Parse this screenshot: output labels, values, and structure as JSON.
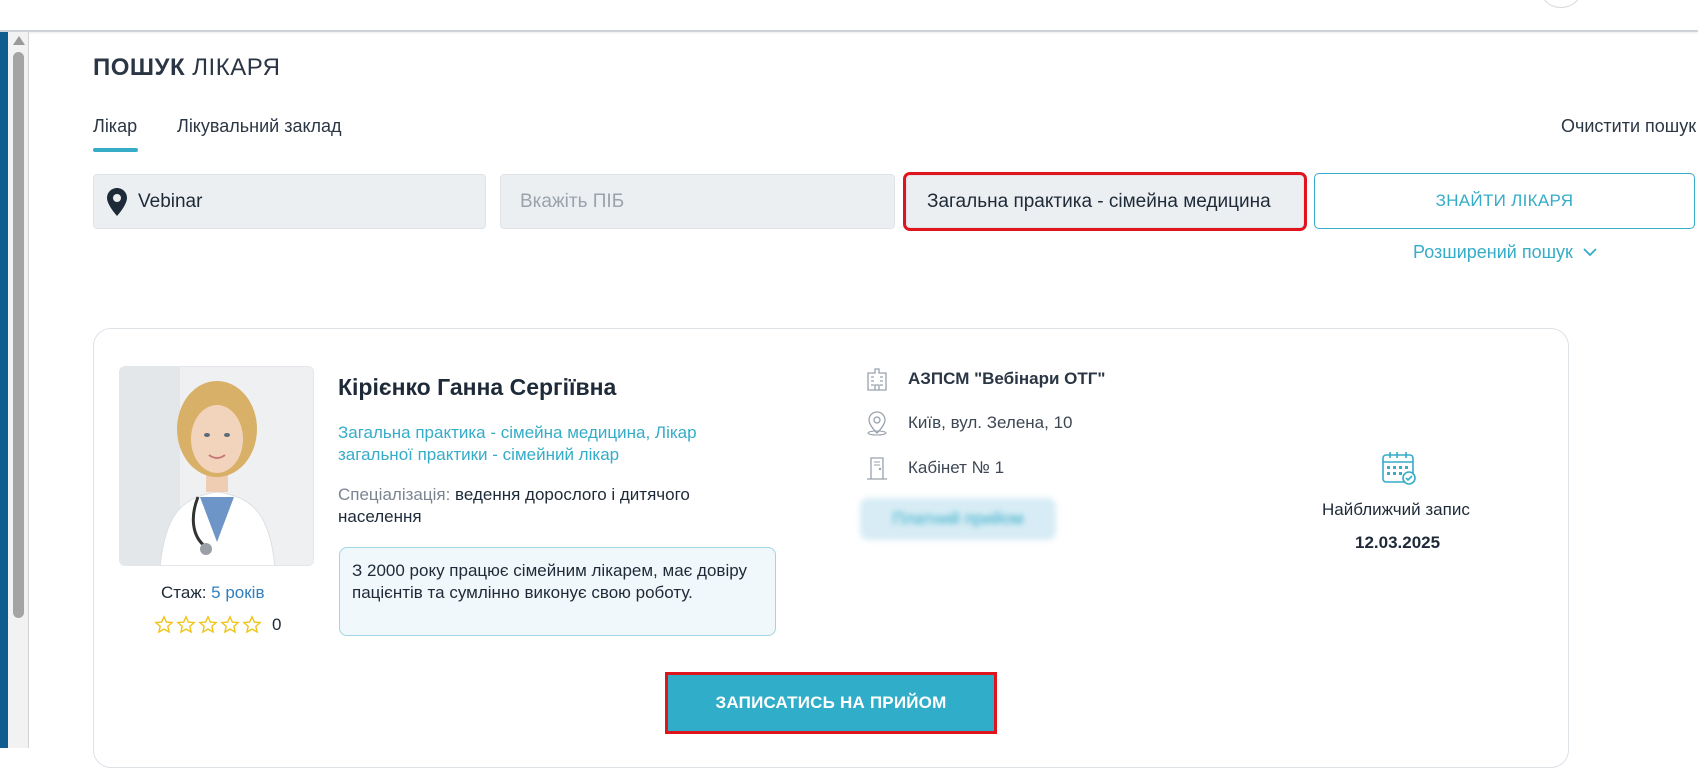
{
  "title": {
    "bold": "ПОШУК",
    "light": "ЛІКАРЯ"
  },
  "tabs": [
    {
      "label": "Лікар",
      "active": true
    },
    {
      "label": "Лікувальний заклад",
      "active": false
    }
  ],
  "clear_search": "Очистити пошук",
  "search": {
    "location_value": "Vebinar",
    "name_placeholder": "Вкажіть ПІБ",
    "specialty_value": "Загальна практика - сімейна медицина",
    "find_button": "ЗНАЙТИ ЛІКАРЯ",
    "advanced": "Розширений пошук"
  },
  "doctor": {
    "name": "Кірієнко Ганна Сергіївна",
    "specialties": "Загальна практика - сімейна медицина, Лікар загальної практики - сімейний лікар",
    "specialization_label": "Спеціалізація:",
    "specialization_value": "ведення дорослого і дитячого населення",
    "about": "З 2000 року працює сімейним лікарем, має довіру пацієнтів та сумлінно виконує свою роботу.",
    "experience_label": "Стаж:",
    "experience_value": "5 років",
    "rating_stars": 0,
    "rating_count": "0",
    "clinic": "АЗПСМ \"Вебінари ОТГ\"",
    "address": "Київ, вул. Зелена, 10",
    "cabinet": "Кабінет № 1",
    "paid_badge": "Платний прийом",
    "nearest_label": "Найближчий запис",
    "nearest_date": "12.03.2025",
    "book_button": "ЗАПИСАТИСЬ НА ПРИЙОМ"
  },
  "colors": {
    "accent": "#35acc8",
    "highlight": "#e0141d",
    "experience": "#2f7fbf",
    "star": "#f0c419"
  }
}
